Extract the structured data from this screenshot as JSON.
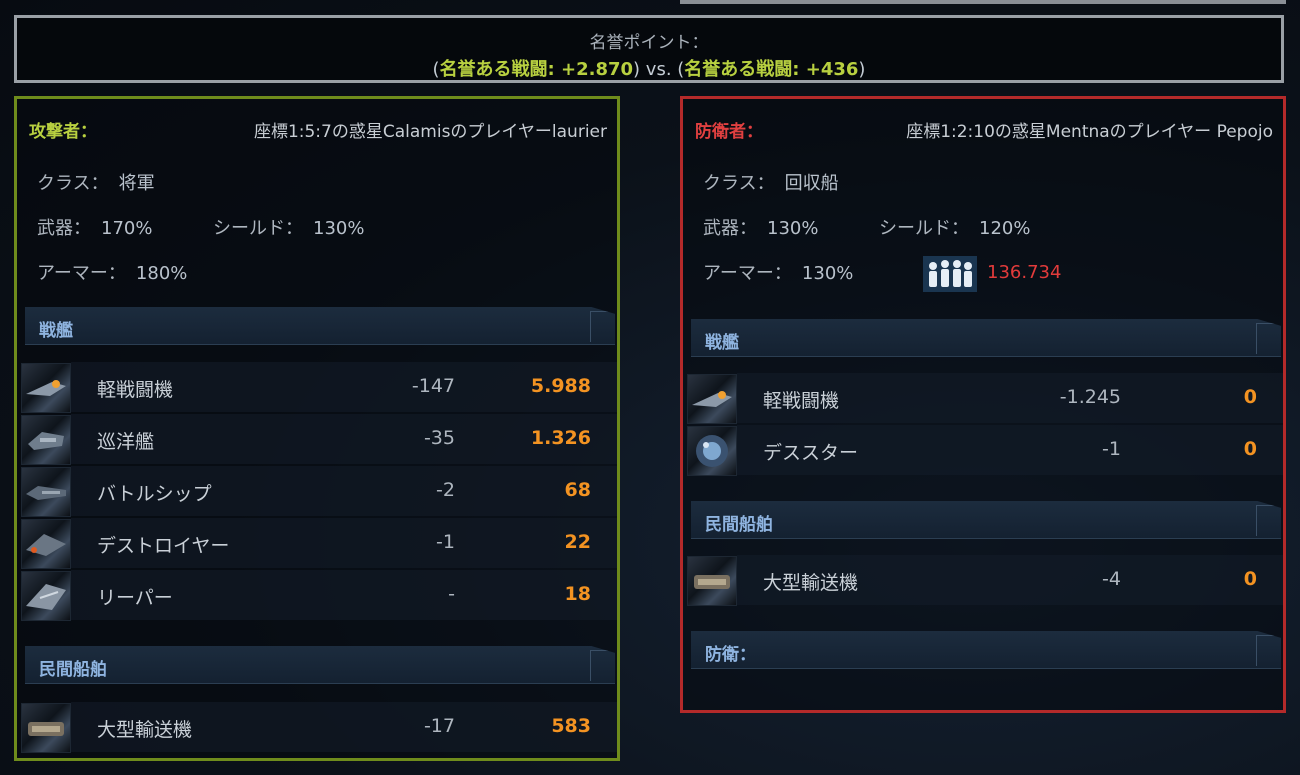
{
  "honor": {
    "title": "名誉ポイント：",
    "open1": "(",
    "attacker": "名誉ある戦闘: +2.870",
    "mid": ") vs. (",
    "defender": "名誉ある戦闘: +436",
    "close": ")"
  },
  "attacker": {
    "role": "攻撃者：",
    "who": "座標1:5:7の惑星Calamisのプレイヤーlaurier",
    "class_label": "クラス：",
    "class_value": "将軍",
    "weapons_label": "武器：",
    "weapons_value": "170%",
    "shields_label": "シールド：",
    "shields_value": "130%",
    "armor_label": "アーマー：",
    "armor_value": "180%",
    "sections": [
      "戦艦",
      "民間船舶"
    ],
    "warships": [
      {
        "name": "軽戦闘機",
        "loss": "-147",
        "value": "5.988",
        "icon": "light-fighter-icon"
      },
      {
        "name": "巡洋艦",
        "loss": "-35",
        "value": "1.326",
        "icon": "cruiser-icon"
      },
      {
        "name": "バトルシップ",
        "loss": "-2",
        "value": "68",
        "icon": "battleship-icon"
      },
      {
        "name": "デストロイヤー",
        "loss": "-1",
        "value": "22",
        "icon": "destroyer-icon"
      },
      {
        "name": "リーパー",
        "loss": "-",
        "value": "18",
        "icon": "reaper-icon"
      }
    ],
    "civil": [
      {
        "name": "大型輸送機",
        "loss": "-17",
        "value": "583",
        "icon": "large-cargo-icon"
      }
    ]
  },
  "defender": {
    "role": "防衛者：",
    "who": "座標1:2:10の惑星Mentnaのプレイヤー Pepojo",
    "class_label": "クラス：",
    "class_value": "回収船",
    "weapons_label": "武器：",
    "weapons_value": "130%",
    "shields_label": "シールド：",
    "shields_value": "120%",
    "armor_label": "アーマー：",
    "armor_value": "130%",
    "population": "136.734",
    "population_icon": "population-icon",
    "sections": [
      "戦艦",
      "民間船舶",
      "防衛："
    ],
    "warships": [
      {
        "name": "軽戦闘機",
        "loss": "-1.245",
        "value": "0",
        "icon": "light-fighter-icon"
      },
      {
        "name": "デススター",
        "loss": "-1",
        "value": "0",
        "icon": "deathstar-icon"
      }
    ],
    "civil": [
      {
        "name": "大型輸送機",
        "loss": "-4",
        "value": "0",
        "icon": "large-cargo-icon"
      }
    ]
  },
  "colors": {
    "attacker_accent": "#b8d040",
    "defender_accent": "#e04040",
    "value_orange": "#f39322",
    "section_text": "#8fb4e0"
  }
}
